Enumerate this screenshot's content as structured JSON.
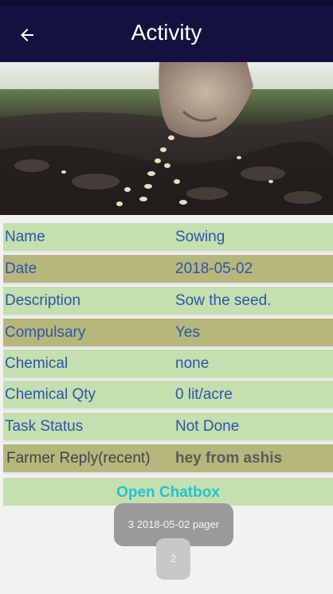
{
  "header": {
    "title": "Activity",
    "back_icon": "arrow-left-icon"
  },
  "hero": {
    "description": "Hand sowing seeds into dark soil"
  },
  "details": [
    {
      "label": "Name",
      "value": "Sowing"
    },
    {
      "label": "Date",
      "value": "2018-05-02"
    },
    {
      "label": "Description",
      "value": "Sow the seed."
    },
    {
      "label": "Compulsary",
      "value": "Yes"
    },
    {
      "label": "Chemical",
      "value": "none"
    },
    {
      "label": "Chemical Qty",
      "value": "0 lit/acre"
    },
    {
      "label": "Task Status",
      "value": "Not Done"
    },
    {
      "label": "Farmer Reply(recent)",
      "value": "hey from ashis"
    }
  ],
  "chat": {
    "label": "Open Chatbox"
  },
  "toast": {
    "text": "3 2018-05-02 pager"
  },
  "pager": {
    "text": "2"
  },
  "colors": {
    "appbar": "#13123f",
    "row_light": "#c4dfb0",
    "row_dark": "#b6b77c",
    "label_text": "#2d57a6",
    "chat_text": "#22c4d2"
  }
}
